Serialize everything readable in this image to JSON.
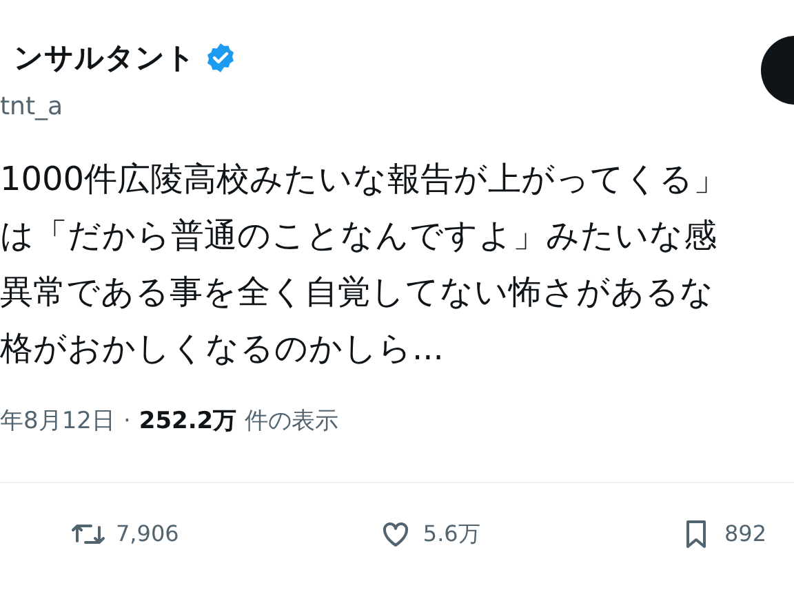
{
  "author": {
    "name": "ンサルタント",
    "verified": true,
    "handle": "tnt_a"
  },
  "post": {
    "lines": [
      "1000件広陵高校みたいな報告が上がってくる」",
      "は「だから普通のことなんですよ」みたいな感",
      "異常である事を全く自覚してない怖さがあるな",
      "格がおかしくなるのかしら..."
    ]
  },
  "meta": {
    "date": "年8月12日",
    "separator": "·",
    "views": "252.2万",
    "views_label": "件の表示"
  },
  "actions": [
    {
      "kind": "repost",
      "count": "7,906"
    },
    {
      "kind": "like",
      "count": "5.6万"
    },
    {
      "kind": "bookmark",
      "count": "892"
    }
  ]
}
